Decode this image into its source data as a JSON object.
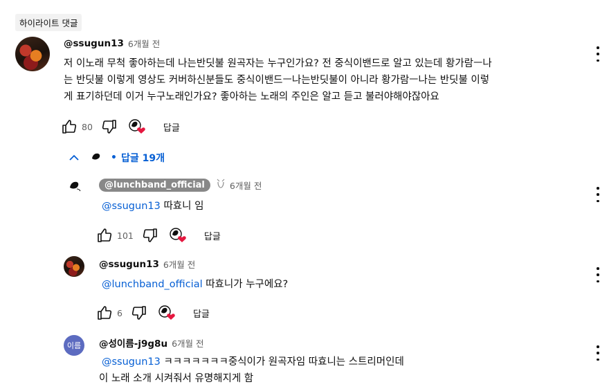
{
  "highlight_label": "하이라이트 댓글",
  "main_comment": {
    "author": "@ssugun13",
    "time": "6개월 전",
    "text_lines": [
      "저 이노래 무척 좋아하는데 나는반딧불 원곡자는 누구인가요? 전 중식이밴드로 알고 있는데 황가람ㅡ나",
      "는 반딧불  이렇게 영상도 커버하신분들도  중식이밴드ㅡ나는반딧불이 아니라 황가람ㅡ나는 반딧불 이렇",
      "게 표기하던데 이거 누구노래인가요? 좋아하는 노래의 주인은 알고 듣고 불러야해야잖아요"
    ],
    "likes": "80",
    "reply_label": "답글"
  },
  "replies_toggle": {
    "count_label": "답글 19개"
  },
  "replies": [
    {
      "author": "@lunchband_official",
      "time": "6개월 전",
      "mention": "@ssugun13",
      "text": "따효니 임",
      "likes": "101",
      "reply_label": "답글"
    },
    {
      "author": "@ssugun13",
      "time": "6개월 전",
      "mention": "@lunchband_official",
      "text": "따효니가 누구에요?",
      "likes": "6",
      "reply_label": "답글"
    },
    {
      "author": "@성이름-j9g8u",
      "avatar_letter": "이름",
      "time": "6개월 전",
      "mention": "@ssugun13",
      "text": "ㅋㅋㅋㅋㅋㅋㅋ중식이가 원곡자임 따효니는 스트리머인데",
      "text_line2": "이 노래 소개 시켜줘서 유명해지게 함"
    }
  ],
  "icons": {
    "like": "thumb-up-icon",
    "dislike": "thumb-down-icon",
    "hearted": "creator-heart-icon",
    "more": "more-vert-icon",
    "collapse": "chevron-up-icon"
  },
  "colors": {
    "link": "#065fd4",
    "heart": "#e5173f",
    "muted": "#606060"
  }
}
